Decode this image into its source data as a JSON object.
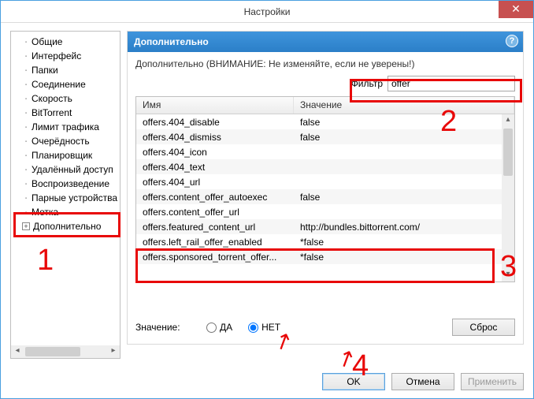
{
  "window": {
    "title": "Настройки",
    "close": "✕"
  },
  "sidebar": {
    "items": [
      {
        "label": "Общие",
        "expandable": false
      },
      {
        "label": "Интерфейс",
        "expandable": false
      },
      {
        "label": "Папки",
        "expandable": false
      },
      {
        "label": "Соединение",
        "expandable": false
      },
      {
        "label": "Скорость",
        "expandable": false
      },
      {
        "label": "BitTorrent",
        "expandable": false
      },
      {
        "label": "Лимит трафика",
        "expandable": false
      },
      {
        "label": "Очерёдность",
        "expandable": false
      },
      {
        "label": "Планировщик",
        "expandable": false
      },
      {
        "label": "Удалённый доступ",
        "expandable": false
      },
      {
        "label": "Воспроизведение",
        "expandable": false
      },
      {
        "label": "Парные устройства",
        "expandable": false
      },
      {
        "label": "Метка",
        "expandable": false
      },
      {
        "label": "Дополнительно",
        "expandable": true
      }
    ]
  },
  "panel": {
    "title": "Дополнительно",
    "hint": "Дополнительно (ВНИМАНИЕ: Не изменяйте, если не уверены!)",
    "help": "?",
    "filter": {
      "label": "Фильтр",
      "value": "offer"
    },
    "columns": {
      "name": "Имя",
      "value": "Значение"
    },
    "rows": [
      {
        "name": "offers.404_disable",
        "value": "false"
      },
      {
        "name": "offers.404_dismiss",
        "value": "false"
      },
      {
        "name": "offers.404_icon",
        "value": ""
      },
      {
        "name": "offers.404_text",
        "value": ""
      },
      {
        "name": "offers.404_url",
        "value": ""
      },
      {
        "name": "offers.content_offer_autoexec",
        "value": "false"
      },
      {
        "name": "offers.content_offer_url",
        "value": ""
      },
      {
        "name": "offers.featured_content_url",
        "value": "http://bundles.bittorrent.com/"
      },
      {
        "name": "offers.left_rail_offer_enabled",
        "value": "*false"
      },
      {
        "name": "offers.sponsored_torrent_offer...",
        "value": "*false"
      }
    ],
    "value_editor": {
      "label": "Значение:",
      "yes": "ДА",
      "no": "НЕТ",
      "selected": "no",
      "reset": "Сброс"
    }
  },
  "buttons": {
    "ok": "OK",
    "cancel": "Отмена",
    "apply": "Применить"
  },
  "annotations": {
    "n1": "1",
    "n2": "2",
    "n3": "3",
    "n4": "4"
  }
}
